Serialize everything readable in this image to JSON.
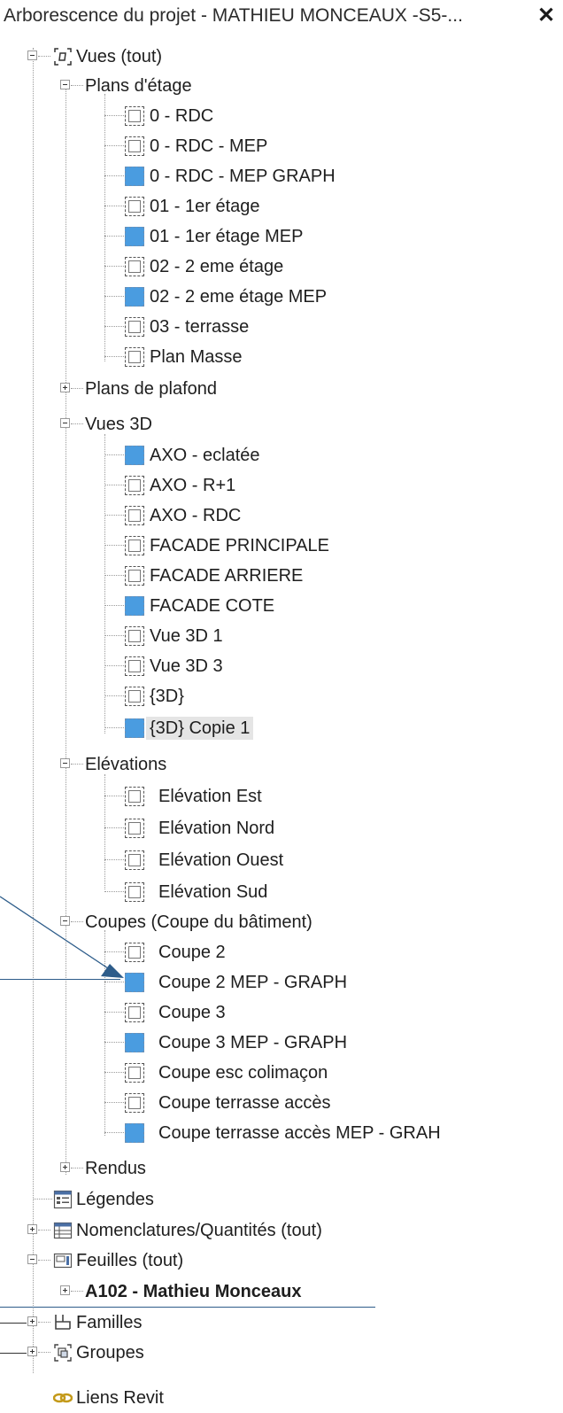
{
  "window": {
    "title": "Arborescence du projet - MATHIEU MONCEAUX -S5-...",
    "close_label": "✕"
  },
  "tree": {
    "root": "Vues (tout)",
    "plans_etage": {
      "label": "Plans d'étage",
      "items": [
        "0 - RDC",
        "0 - RDC - MEP",
        "0 - RDC - MEP GRAPH",
        "01 - 1er étage",
        "01 - 1er étage MEP",
        "02 - 2 eme étage",
        "02 - 2 eme étage MEP",
        "03 - terrasse",
        "Plan Masse"
      ]
    },
    "plans_plafond": {
      "label": "Plans de plafond"
    },
    "vues_3d": {
      "label": "Vues 3D",
      "items": [
        "AXO - eclatée",
        "AXO - R+1",
        "AXO - RDC",
        "FACADE  PRINCIPALE",
        "FACADE ARRIERE",
        "FACADE COTE",
        "Vue 3D 1",
        "Vue 3D 3",
        "{3D}",
        "{3D} Copie 1"
      ]
    },
    "elevations": {
      "label": "Elévations",
      "items": [
        "Elévation Est",
        "Elévation Nord",
        "Elévation Ouest",
        "Elévation Sud"
      ]
    },
    "coupes": {
      "label": "Coupes (Coupe du bâtiment)",
      "items": [
        "Coupe 2",
        "Coupe 2 MEP - GRAPH",
        "Coupe 3",
        "Coupe 3 MEP - GRAPH",
        "Coupe esc colimaçon",
        "Coupe terrasse accès",
        "Coupe terrasse accès MEP  - GRAH"
      ]
    },
    "rendus": {
      "label": "Rendus"
    },
    "legendes": {
      "label": "Légendes"
    },
    "nomenclatures": {
      "label": "Nomenclatures/Quantités (tout)"
    },
    "feuilles": {
      "label": "Feuilles (tout)",
      "child": "A102 - Mathieu Monceaux"
    },
    "familles": {
      "label": "Familles"
    },
    "groupes": {
      "label": "Groupes"
    },
    "liens": {
      "label": "Liens Revit"
    }
  },
  "colors": {
    "view_fill": "#4a9ce0",
    "annotation_line": "#2d5c8a",
    "selected_bg": "#e5e5e5"
  }
}
